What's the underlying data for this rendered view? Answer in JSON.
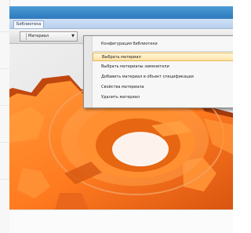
{
  "library_tab": {
    "label": "Библиотека"
  },
  "toolbar": {
    "material_button_label": "Материал",
    "dropdown_symbol": "▼"
  },
  "context_menu": {
    "items": [
      {
        "label": "Конфигурация библиотеки"
      },
      {
        "label": "Выбрать материал"
      },
      {
        "label": "Выбрать материалы заменители"
      },
      {
        "label": "Добавить материал в объект спецификации"
      },
      {
        "label": "Свойства материала"
      },
      {
        "label": "Удалить материал"
      }
    ]
  },
  "colors": {
    "window_frame": "#2f79bd",
    "model_orange": "#ff7a1f",
    "highlight": "#ffe3a8"
  },
  "icons": [
    "dropdown-arrow-icon",
    "pointer-cursor-icon"
  ]
}
